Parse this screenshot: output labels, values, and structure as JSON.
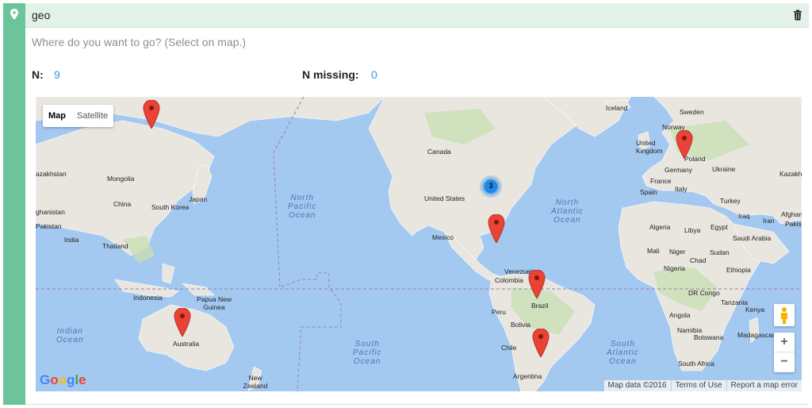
{
  "field": {
    "title": "geo",
    "question": "Where do you want to go? (Select on map.)",
    "n_label": "N:",
    "n_value": "9",
    "missing_label": "N missing:",
    "missing_value": "0"
  },
  "map": {
    "type_buttons": [
      "Map",
      "Satellite"
    ],
    "active_type": "Map",
    "cluster_count": "3",
    "logo": "Google",
    "attribution": [
      "Map data ©2016",
      "Terms of Use",
      "Report a map error"
    ],
    "zoom_in": "+",
    "zoom_out": "−",
    "colors": {
      "water": "#a4c9f0",
      "land": "#e8e6df",
      "green": "#c8dfb1",
      "marker": "#ea4335",
      "cluster": "#1e88e5",
      "accent": "#6cc49a"
    },
    "oceans": [
      {
        "name": "North\nPacific\nOcean"
      },
      {
        "name": "North\nAtlantic\nOcean"
      },
      {
        "name": "Indian\nOcean"
      },
      {
        "name": "South\nPacific\nOcean"
      },
      {
        "name": "South\nAtlantic\nOcean"
      }
    ],
    "labels": [
      "Iceland",
      "Sweden",
      "Norway",
      "United Kingdom",
      "Poland",
      "Germany",
      "Ukraine",
      "France",
      "Italy",
      "Spain",
      "Turkey",
      "Iraq",
      "Iran",
      "Algeria",
      "Libya",
      "Egypt",
      "Saudi Arabia",
      "Mali",
      "Niger",
      "Chad",
      "Sudan",
      "Nigeria",
      "Ethiopia",
      "DR Congo",
      "Kenya",
      "Tanzania",
      "Angola",
      "Namibia",
      "Botswana",
      "Madagascar",
      "South Africa",
      "Canada",
      "United States",
      "Mexico",
      "Venezuela",
      "Colombia",
      "Brazil",
      "Peru",
      "Bolivia",
      "Chile",
      "Argentina",
      "Mongolia",
      "China",
      "Japan",
      "South Korea",
      "India",
      "Pakistan",
      "Thailand",
      "Indonesia",
      "Papua New Guinea",
      "Australia",
      "New Zealand",
      "azakhstan",
      "ghanistan",
      "Kazakh",
      "Afghan",
      "Pakis"
    ]
  }
}
